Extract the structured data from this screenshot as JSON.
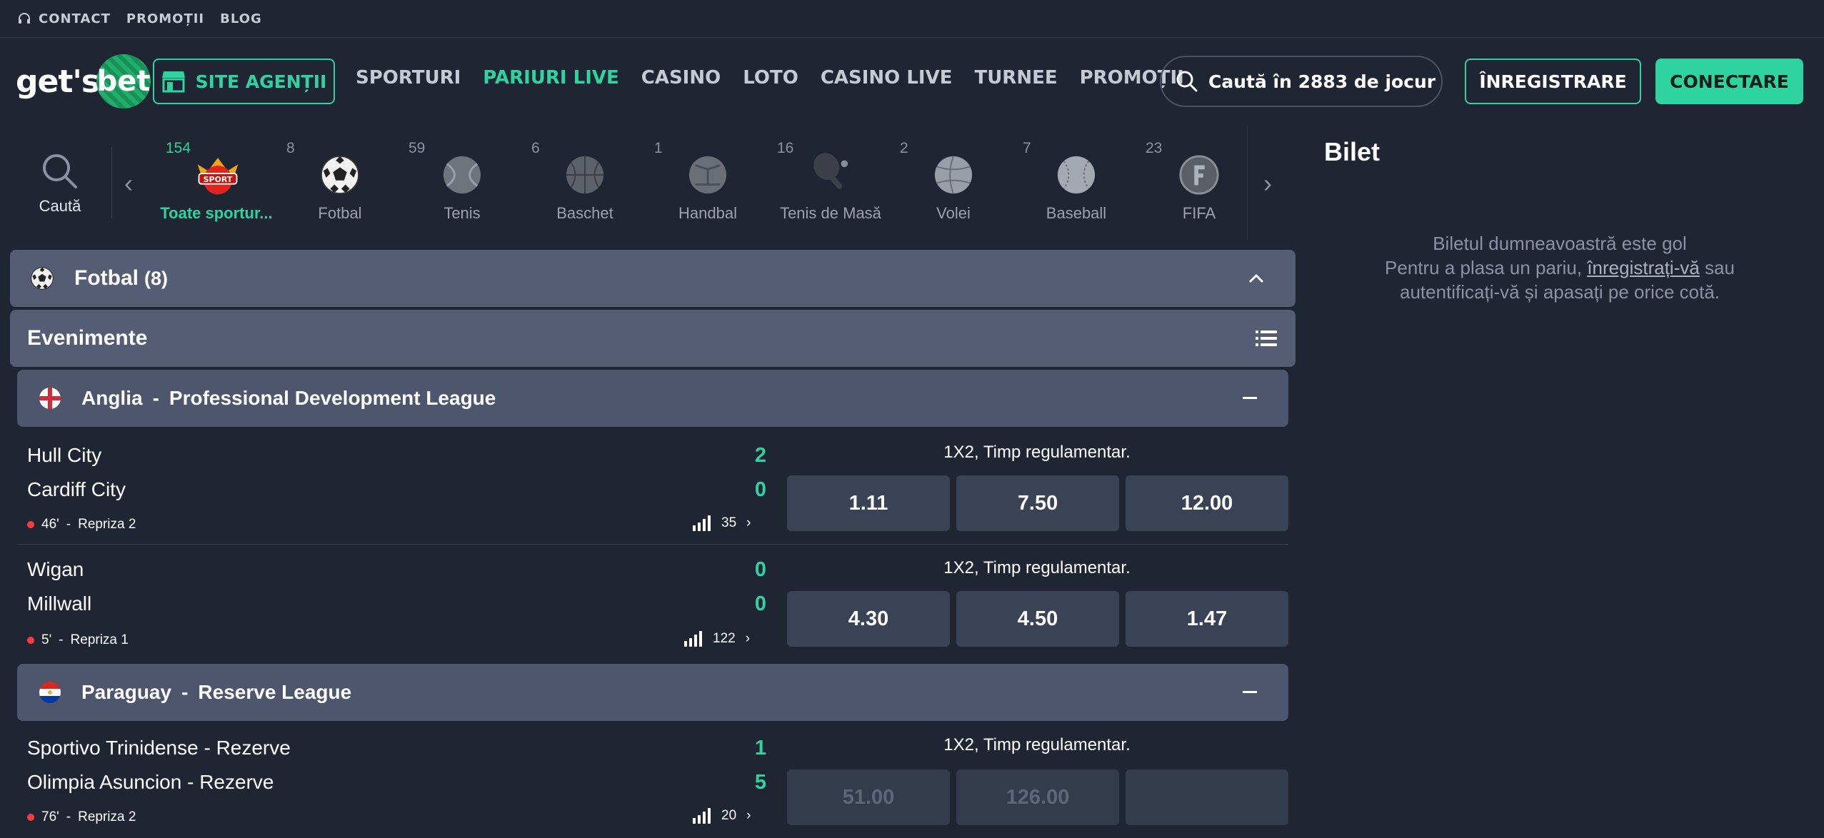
{
  "topbar": {
    "contact": "CONTACT",
    "promotions": "PROMOȚII",
    "blog": "BLOG"
  },
  "header": {
    "logo_text": "get's",
    "logo_ball_text": "bet",
    "agents_button": "SITE AGENȚII",
    "nav": [
      "SPORTURI",
      "PARIURI LIVE",
      "CASINO",
      "LOTO",
      "CASINO LIVE",
      "TURNEE",
      "PROMOȚII"
    ],
    "active_nav": "PARIURI LIVE",
    "search_placeholder": "Caută în 2883 de jocuri",
    "register_button": "ÎNREGISTRARE",
    "login_button": "CONECTARE"
  },
  "carousel": {
    "search_label": "Caută",
    "sports": [
      {
        "count": "154",
        "name": "Toate sportur...",
        "icon": "all-sports-icon",
        "active": true
      },
      {
        "count": "8",
        "name": "Fotbal",
        "icon": "football-icon"
      },
      {
        "count": "59",
        "name": "Tenis",
        "icon": "tennis-ball-icon"
      },
      {
        "count": "6",
        "name": "Baschet",
        "icon": "basketball-icon"
      },
      {
        "count": "1",
        "name": "Handbal",
        "icon": "handball-icon"
      },
      {
        "count": "16",
        "name": "Tenis de Masă",
        "icon": "table-tennis-icon"
      },
      {
        "count": "2",
        "name": "Volei",
        "icon": "volleyball-icon"
      },
      {
        "count": "7",
        "name": "Baseball",
        "icon": "baseball-icon"
      },
      {
        "count": "23",
        "name": "FIFA",
        "icon": "fifa-icon"
      }
    ],
    "all_sports_badge": "SPORT"
  },
  "main": {
    "sport_title": "Fotbal",
    "sport_count": "(8)",
    "events_title": "Evenimente",
    "leagues": [
      {
        "country": "Anglia",
        "separator": "-",
        "name": "Professional Development League",
        "events": [
          {
            "home": "Hull City",
            "away": "Cardiff City",
            "home_score": "2",
            "away_score": "0",
            "time": "46'",
            "period": "Repriza 2",
            "markets": "35",
            "market_label": "1X2, Timp regulamentar.",
            "odds": [
              "1.11",
              "7.50",
              "12.00"
            ]
          },
          {
            "home": "Wigan",
            "away": "Millwall",
            "home_score": "0",
            "away_score": "0",
            "time": "5'",
            "period": "Repriza 1",
            "markets": "122",
            "market_label": "1X2, Timp regulamentar.",
            "odds": [
              "4.30",
              "4.50",
              "1.47"
            ]
          }
        ]
      },
      {
        "country": "Paraguay",
        "separator": "-",
        "name": "Reserve League",
        "events": [
          {
            "home": "Sportivo Trinidense - Rezerve",
            "away": "Olimpia Asuncion - Rezerve",
            "home_score": "1",
            "away_score": "5",
            "time": "76'",
            "period": "Repriza 2",
            "markets": "20",
            "market_label": "1X2, Timp regulamentar.",
            "odds": [
              "51.00",
              "126.00",
              ""
            ]
          }
        ]
      }
    ]
  },
  "bilet": {
    "title": "Bilet",
    "line1": "Biletul dumneavoastră este gol",
    "line2_pre": "Pentru a plasa un pariu, ",
    "line2_link": "înregistrați-vă",
    "line2_post": " sau",
    "line3": "autentificați-vă și apasați pe orice cotă."
  },
  "colors": {
    "background": "#1f2533",
    "accent": "#2ed3a0",
    "panel": "#545d73",
    "live_dot": "#ff3b3b"
  }
}
